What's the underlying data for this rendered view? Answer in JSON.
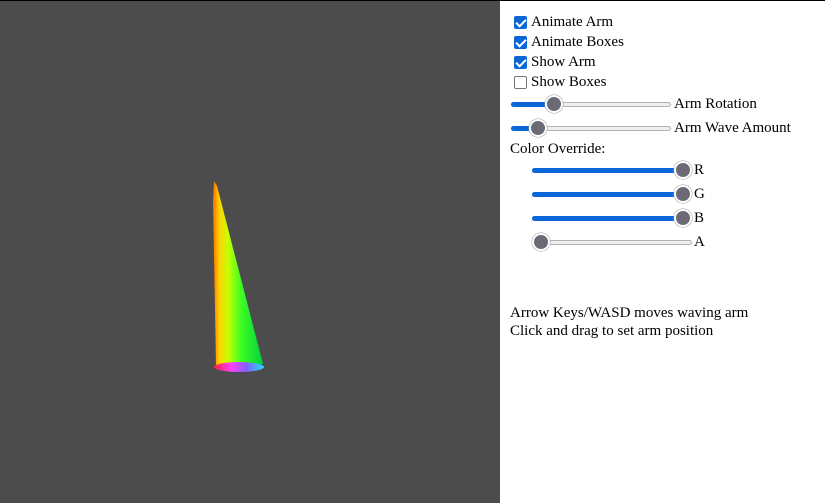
{
  "checkboxes": [
    {
      "label": "Animate Arm",
      "checked": true
    },
    {
      "label": "Animate Boxes",
      "checked": true
    },
    {
      "label": "Show Arm",
      "checked": true
    },
    {
      "label": "Show Boxes",
      "checked": false
    }
  ],
  "sliders": {
    "arm_rotation": {
      "label": "Arm Rotation",
      "value": 0.24
    },
    "arm_wave_amount": {
      "label": "Arm Wave Amount",
      "value": 0.13
    }
  },
  "color_override": {
    "label": "Color Override:",
    "r": {
      "label": "R",
      "value": 1.0
    },
    "g": {
      "label": "G",
      "value": 1.0
    },
    "b": {
      "label": "B",
      "value": 1.0
    },
    "a": {
      "label": "A",
      "value": 0.0
    }
  },
  "instructions": {
    "line1": "Arrow Keys/WASD moves waving arm",
    "line2": "Click and drag to set arm position"
  },
  "colors": {
    "viewport_bg": "#4c4c4c",
    "accent": "#0b67d8",
    "thumb": "#6a6a75"
  }
}
